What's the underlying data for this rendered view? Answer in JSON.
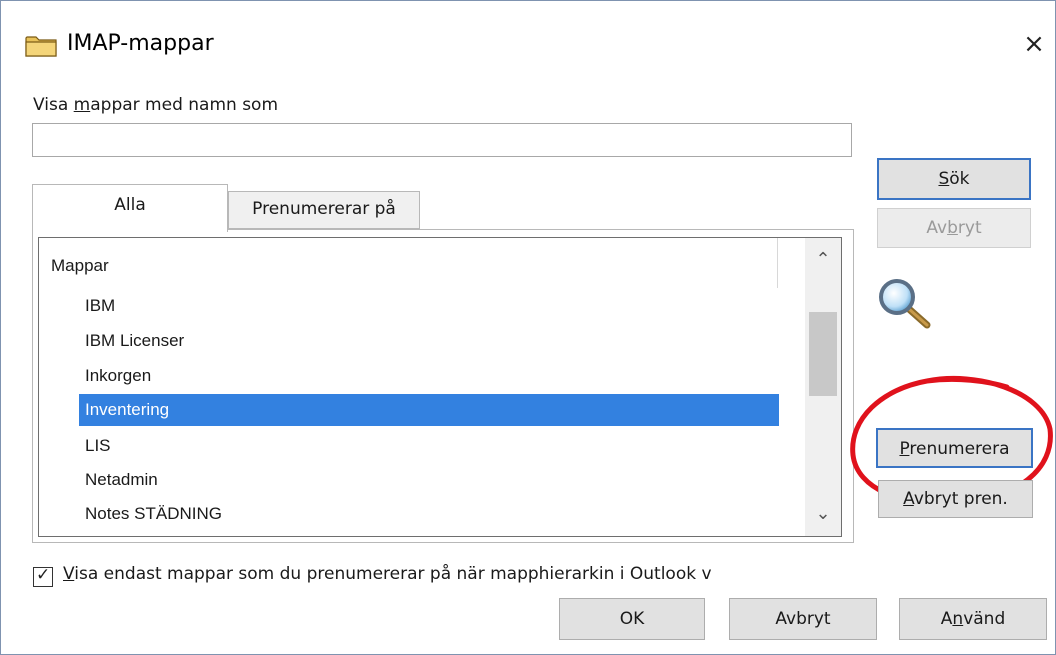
{
  "window": {
    "title": "IMAP-mappar",
    "close_glyph": "×",
    "icon": "folder-icon"
  },
  "filter": {
    "label_pre": "Visa ",
    "label_ul": "m",
    "label_post": "appar med namn som",
    "value": ""
  },
  "tabs": [
    {
      "label": "Alla",
      "active": true
    },
    {
      "label": "Prenumererar på",
      "active": false
    }
  ],
  "folder_list": {
    "header": "Mappar",
    "items": [
      {
        "name": "IBM",
        "selected": false
      },
      {
        "name": "IBM Licenser",
        "selected": false
      },
      {
        "name": "Inkorgen",
        "selected": false
      },
      {
        "name": "Inventering",
        "selected": true
      },
      {
        "name": "LIS",
        "selected": false
      },
      {
        "name": "Netadmin",
        "selected": false
      },
      {
        "name": "Notes STÄDNING",
        "selected": false
      }
    ],
    "scroll_up_glyph": "⌃",
    "scroll_down_glyph": "⌄"
  },
  "buttons": {
    "search_ul": "S",
    "search_rest": "ök",
    "cancel_search_pre": "Av",
    "cancel_search_ul": "b",
    "cancel_search_post": "ryt",
    "subscribe_ul": "P",
    "subscribe_rest": "renumerera",
    "unsubscribe_ul": "A",
    "unsubscribe_rest": "vbryt pren.",
    "ok": "OK",
    "cancel": "Avbryt",
    "apply_pre": "A",
    "apply_ul": "n",
    "apply_post": "vänd"
  },
  "checkbox": {
    "checked": true,
    "label_ul": "V",
    "label_rest": "isa endast mappar som du prenumererar på när mapphierarkin i Outlook v"
  },
  "colors": {
    "selection": "#3381e0",
    "annotation_circle": "#e0121c",
    "default_button_border": "#3a74c4"
  }
}
